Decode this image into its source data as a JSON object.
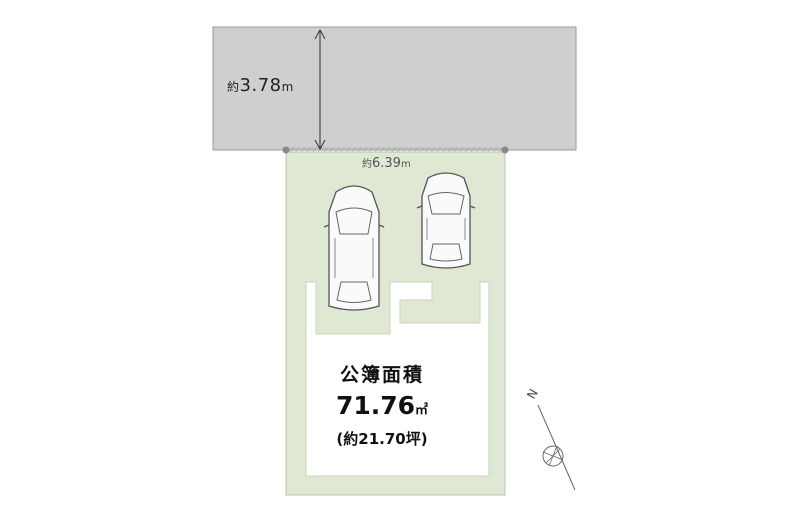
{
  "road": {
    "width_prefix": "約",
    "width_value": "3.78",
    "width_unit": "m"
  },
  "frontage": {
    "prefix": "約",
    "value": "6.39",
    "unit": "m"
  },
  "lot_area": {
    "title": "公簿面積",
    "value": "71.76",
    "unit": "㎡",
    "tsubo_text": "(約21.70坪)"
  },
  "compass": {
    "north_letter": "N"
  },
  "colors": {
    "road_fill": "#cfcfcf",
    "lot_fill": "#dfe8d3",
    "building_fill": "#ffffff"
  },
  "icons": [
    "car-icon",
    "car-icon",
    "compass-icon"
  ]
}
